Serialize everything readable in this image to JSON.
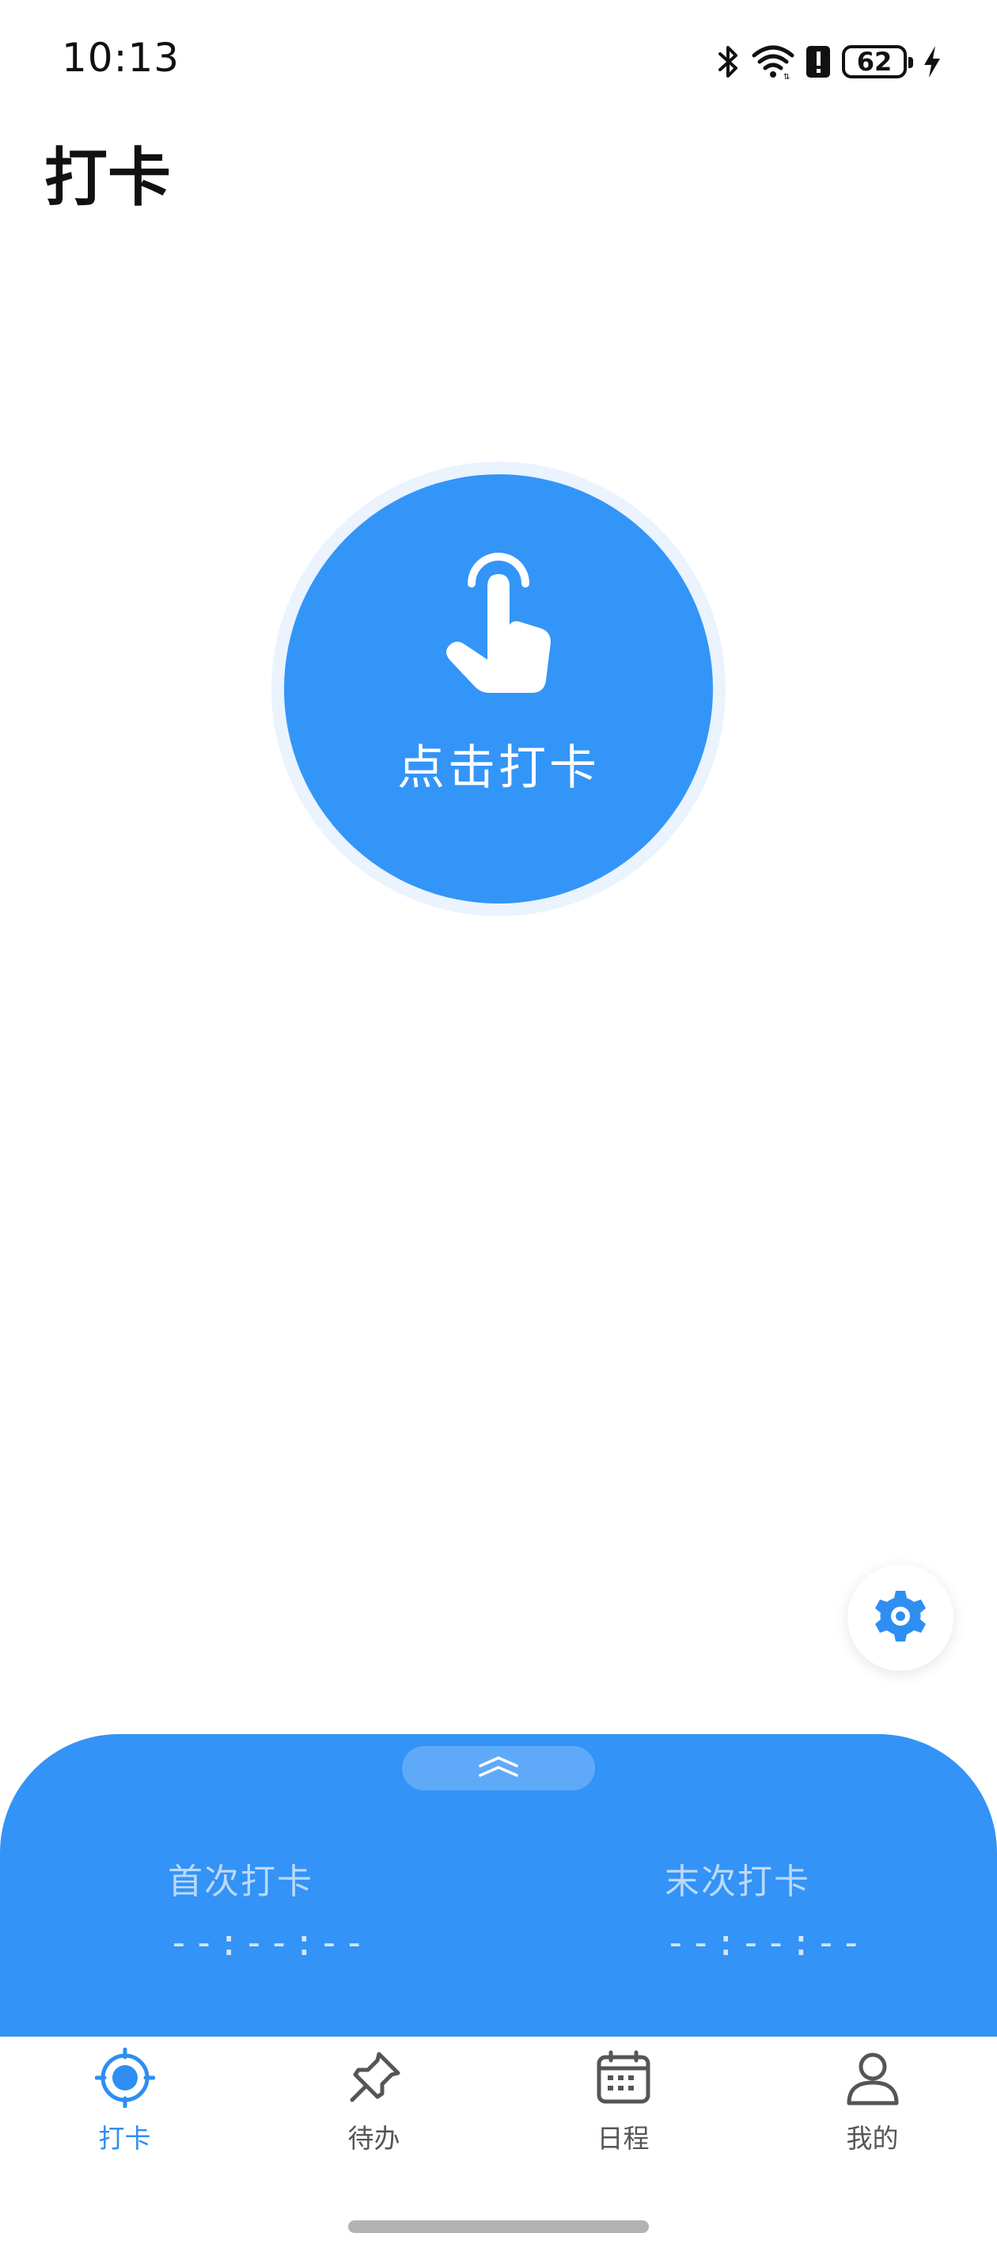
{
  "status_bar": {
    "time": "10:13",
    "battery_level": "62",
    "icons": [
      "bluetooth-icon",
      "wifi-icon",
      "alert-icon",
      "battery-icon",
      "charging-icon"
    ]
  },
  "header": {
    "title": "打卡"
  },
  "punch": {
    "label": "点击打卡",
    "icon": "tap-hand-icon",
    "color": "#3395f7"
  },
  "settings": {
    "icon": "gear-icon"
  },
  "records": {
    "expand_icon": "chevron-double-up-icon",
    "first_label": "首次打卡",
    "first_time": "--:--:--",
    "last_label": "末次打卡",
    "last_time": "--:--:--",
    "panel_color": "#3393f6"
  },
  "tabs": [
    {
      "label": "打卡",
      "icon": "target-icon",
      "active": true
    },
    {
      "label": "待办",
      "icon": "pin-icon",
      "active": false
    },
    {
      "label": "日程",
      "icon": "calendar-icon",
      "active": false
    },
    {
      "label": "我的",
      "icon": "user-icon",
      "active": false
    }
  ],
  "colors": {
    "accent": "#2f8ef2",
    "inactive": "#555555"
  }
}
